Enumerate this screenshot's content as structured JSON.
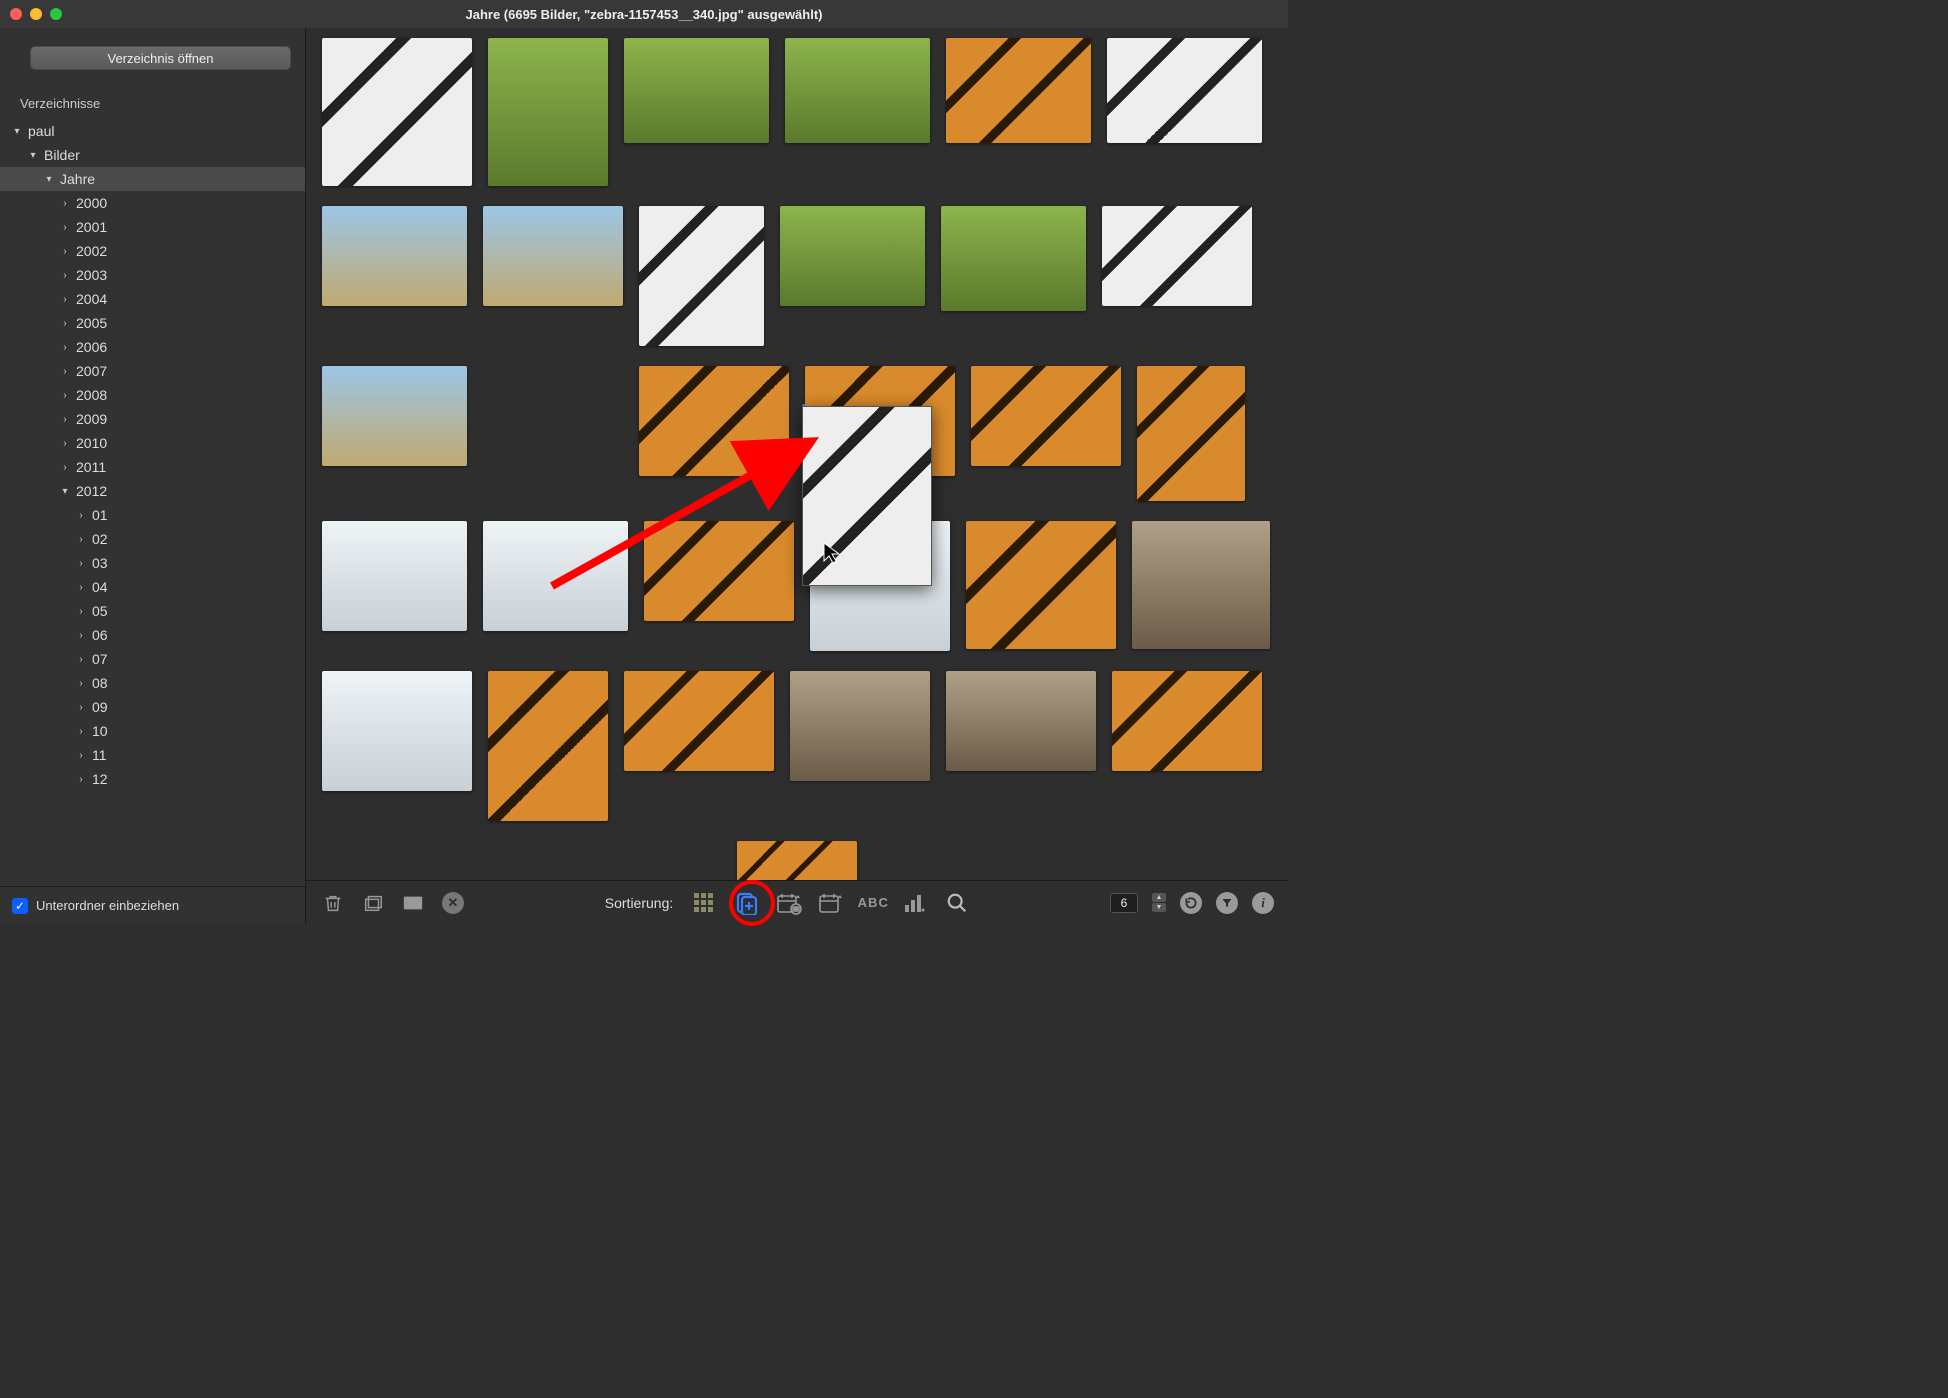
{
  "window": {
    "title": "Jahre (6695 Bilder, \"zebra-1157453__340.jpg\" ausgewählt)"
  },
  "sidebar": {
    "open_button": "Verzeichnis öffnen",
    "section_label": "Verzeichnisse",
    "include_subfolders_label": "Unterordner einbeziehen",
    "include_subfolders_checked": true,
    "tree": [
      {
        "label": "paul",
        "depth": 0,
        "expanded": true,
        "selected": false
      },
      {
        "label": "Bilder",
        "depth": 1,
        "expanded": true,
        "selected": false
      },
      {
        "label": "Jahre",
        "depth": 2,
        "expanded": true,
        "selected": true
      },
      {
        "label": "2000",
        "depth": 3,
        "expanded": false,
        "selected": false
      },
      {
        "label": "2001",
        "depth": 3,
        "expanded": false,
        "selected": false
      },
      {
        "label": "2002",
        "depth": 3,
        "expanded": false,
        "selected": false
      },
      {
        "label": "2003",
        "depth": 3,
        "expanded": false,
        "selected": false
      },
      {
        "label": "2004",
        "depth": 3,
        "expanded": false,
        "selected": false
      },
      {
        "label": "2005",
        "depth": 3,
        "expanded": false,
        "selected": false
      },
      {
        "label": "2006",
        "depth": 3,
        "expanded": false,
        "selected": false
      },
      {
        "label": "2007",
        "depth": 3,
        "expanded": false,
        "selected": false
      },
      {
        "label": "2008",
        "depth": 3,
        "expanded": false,
        "selected": false
      },
      {
        "label": "2009",
        "depth": 3,
        "expanded": false,
        "selected": false
      },
      {
        "label": "2010",
        "depth": 3,
        "expanded": false,
        "selected": false
      },
      {
        "label": "2011",
        "depth": 3,
        "expanded": false,
        "selected": false
      },
      {
        "label": "2012",
        "depth": 3,
        "expanded": true,
        "selected": false
      },
      {
        "label": "01",
        "depth": 4,
        "expanded": false,
        "selected": false
      },
      {
        "label": "02",
        "depth": 4,
        "expanded": false,
        "selected": false
      },
      {
        "label": "03",
        "depth": 4,
        "expanded": false,
        "selected": false
      },
      {
        "label": "04",
        "depth": 4,
        "expanded": false,
        "selected": false
      },
      {
        "label": "05",
        "depth": 4,
        "expanded": false,
        "selected": false
      },
      {
        "label": "06",
        "depth": 4,
        "expanded": false,
        "selected": false
      },
      {
        "label": "07",
        "depth": 4,
        "expanded": false,
        "selected": false
      },
      {
        "label": "08",
        "depth": 4,
        "expanded": false,
        "selected": false
      },
      {
        "label": "09",
        "depth": 4,
        "expanded": false,
        "selected": false
      },
      {
        "label": "10",
        "depth": 4,
        "expanded": false,
        "selected": false
      },
      {
        "label": "11",
        "depth": 4,
        "expanded": false,
        "selected": false
      },
      {
        "label": "12",
        "depth": 4,
        "expanded": false,
        "selected": false
      }
    ]
  },
  "bottombar": {
    "sort_label": "Sortierung:",
    "columns_value": "6",
    "sort_modes": {
      "grid": "grid-icon",
      "manual": "manual-sort-icon",
      "date_taken": "date-taken-sort-icon",
      "date_file": "date-file-sort-icon",
      "name": "name-sort-icon",
      "size": "size-sort-icon"
    },
    "sort_active": "manual"
  },
  "annotation": {
    "highlight": "red-circle",
    "arrow": "red-arrow"
  }
}
